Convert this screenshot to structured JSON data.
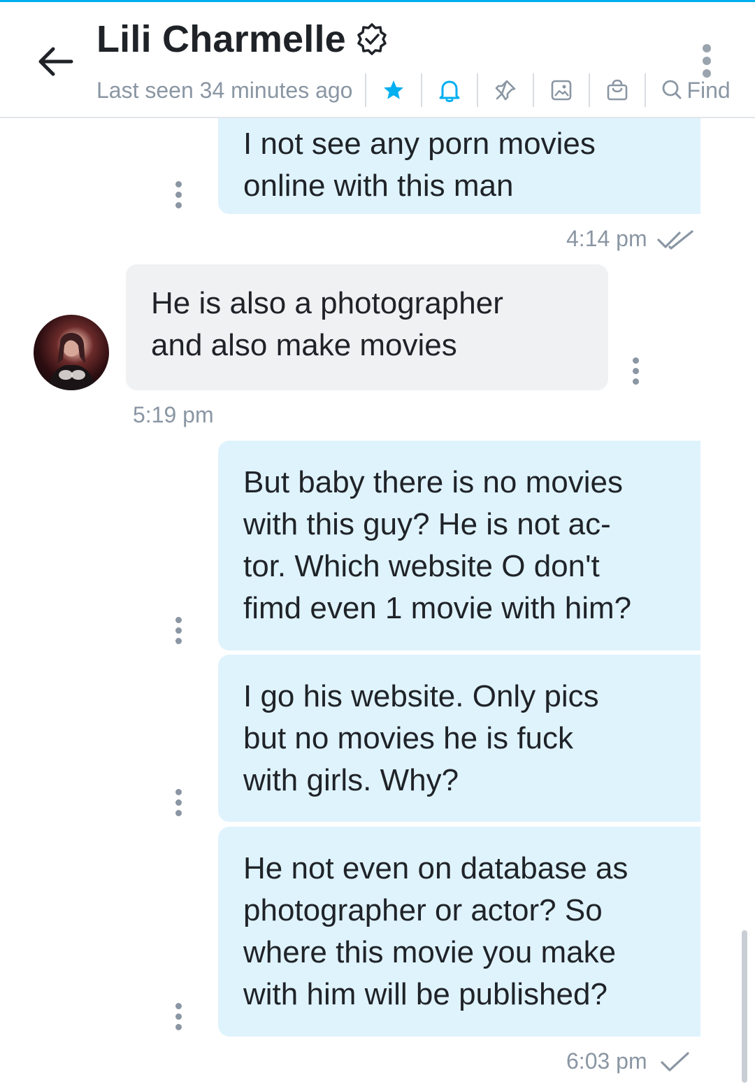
{
  "header": {
    "title": "Lili Charmelle",
    "last_seen": "Last seen 34 minutes ago",
    "find_label": "Find",
    "accent_color": "#00aff0",
    "icons": [
      "back-arrow-icon",
      "verified-badge-icon",
      "more-vertical-icon",
      "star-icon",
      "bell-icon",
      "pin-icon",
      "image-icon",
      "shopping-bag-icon",
      "search-icon"
    ]
  },
  "messages": [
    {
      "id": "m1",
      "direction": "outgoing",
      "lines": [
        "I not see any porn movies",
        "online with this man"
      ]
    },
    {
      "id": "m2",
      "direction": "incoming",
      "lines": [
        "He is also a photographer",
        "and also make movies"
      ]
    },
    {
      "id": "m3",
      "direction": "outgoing",
      "lines": [
        "But baby there is no movies",
        "with this guy? He is not ac-",
        "tor. Which website O don't",
        "fimd even 1 movie with him?"
      ]
    },
    {
      "id": "m4",
      "direction": "outgoing",
      "lines": [
        "I go his website. Only pics",
        "but no movies he is fuck",
        "with girls. Why?"
      ]
    },
    {
      "id": "m5",
      "direction": "outgoing",
      "lines": [
        "He not even on database as",
        "photographer or actor? So",
        "where this movie you make",
        "with him will be published?"
      ]
    }
  ],
  "timestamps": {
    "t1": "4:14 pm",
    "t2": "5:19 pm",
    "t3": "6:03 pm"
  },
  "status_icons": {
    "t1": "double-check-icon",
    "t3": "single-check-icon"
  }
}
